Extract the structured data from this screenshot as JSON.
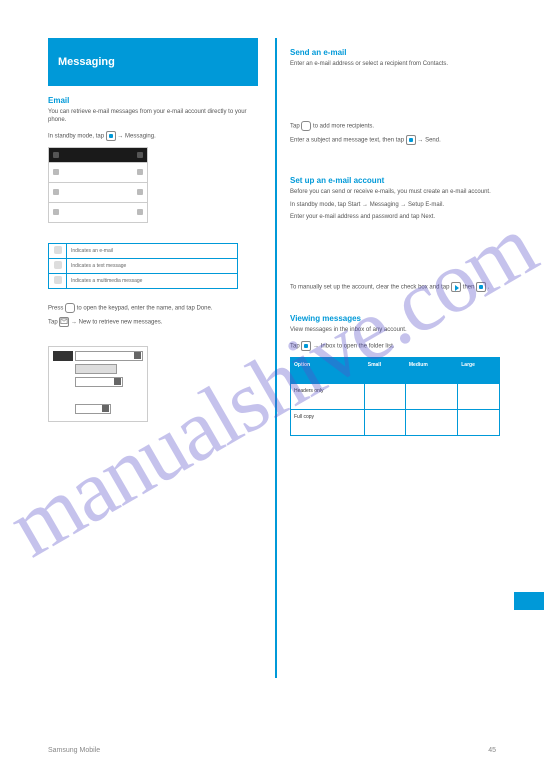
{
  "watermark": "manualshive.com",
  "left": {
    "banner": "Messaging",
    "intro_head": "Email",
    "intro_text": "You can retrieve e-mail messages from your e-mail account directly to your phone.",
    "step1_pre": "In standby mode, tap",
    "step1_post": " → Messaging.",
    "screen_rows": {
      "r1a": "",
      "r1b": "",
      "r2a": "",
      "r2b": "",
      "r3a": "",
      "r3b": ""
    },
    "icons_table": {
      "c1": "Indicates an e-mail",
      "c2": "Indicates a text message",
      "c3": "Indicates a multimedia message"
    },
    "step2_a": "Press ",
    "step2_b": " to open the keypad, enter the name, and tap Done.",
    "step2_c": "Tap ",
    "step2_d": " → New to retrieve new messages.",
    "compose_fields": {
      "to": "",
      "subject": "",
      "body": ""
    }
  },
  "right": {
    "sect1_head": "Send an e-mail",
    "sect1_s1": "Enter an e-mail address or select a recipient from Contacts.",
    "sect1_s2a": "Tap ",
    "sect1_s2b": " to add more recipients.",
    "sect1_s3a": "Enter a subject and message text, then tap ",
    "sect1_s3b": " → Send.",
    "sect2_head": "Set up an e-mail account",
    "sect2_text": "Before you can send or receive e-mails, you must create an e-mail account.",
    "sect2_s1": "In standby mode, tap Start → Messaging → Setup E-mail.",
    "sect2_s2": "Enter your e-mail address and password and tap Next.",
    "sect2_s3a": "To manually set up the account, clear the check box and tap ",
    "sect2_s3b": " then ",
    "sect2_s3c": ".",
    "sect3_head": "Viewing messages",
    "sect3_text": "View messages in the inbox of any account.",
    "sect3_s1a": "Tap ",
    "sect3_s1b": " → Inbox to open the folder list.",
    "options_table": {
      "h1": "Option",
      "h2": "Small",
      "h3": "Medium",
      "h4": "Large",
      "r1c1": "Headers only",
      "r1c2": "",
      "r1c3": "",
      "r1c4": "",
      "r2c1": "Full copy",
      "r2c2": "",
      "r2c3": "",
      "r2c4": ""
    }
  },
  "footer": {
    "left": "Samsung Mobile",
    "right": "45"
  }
}
